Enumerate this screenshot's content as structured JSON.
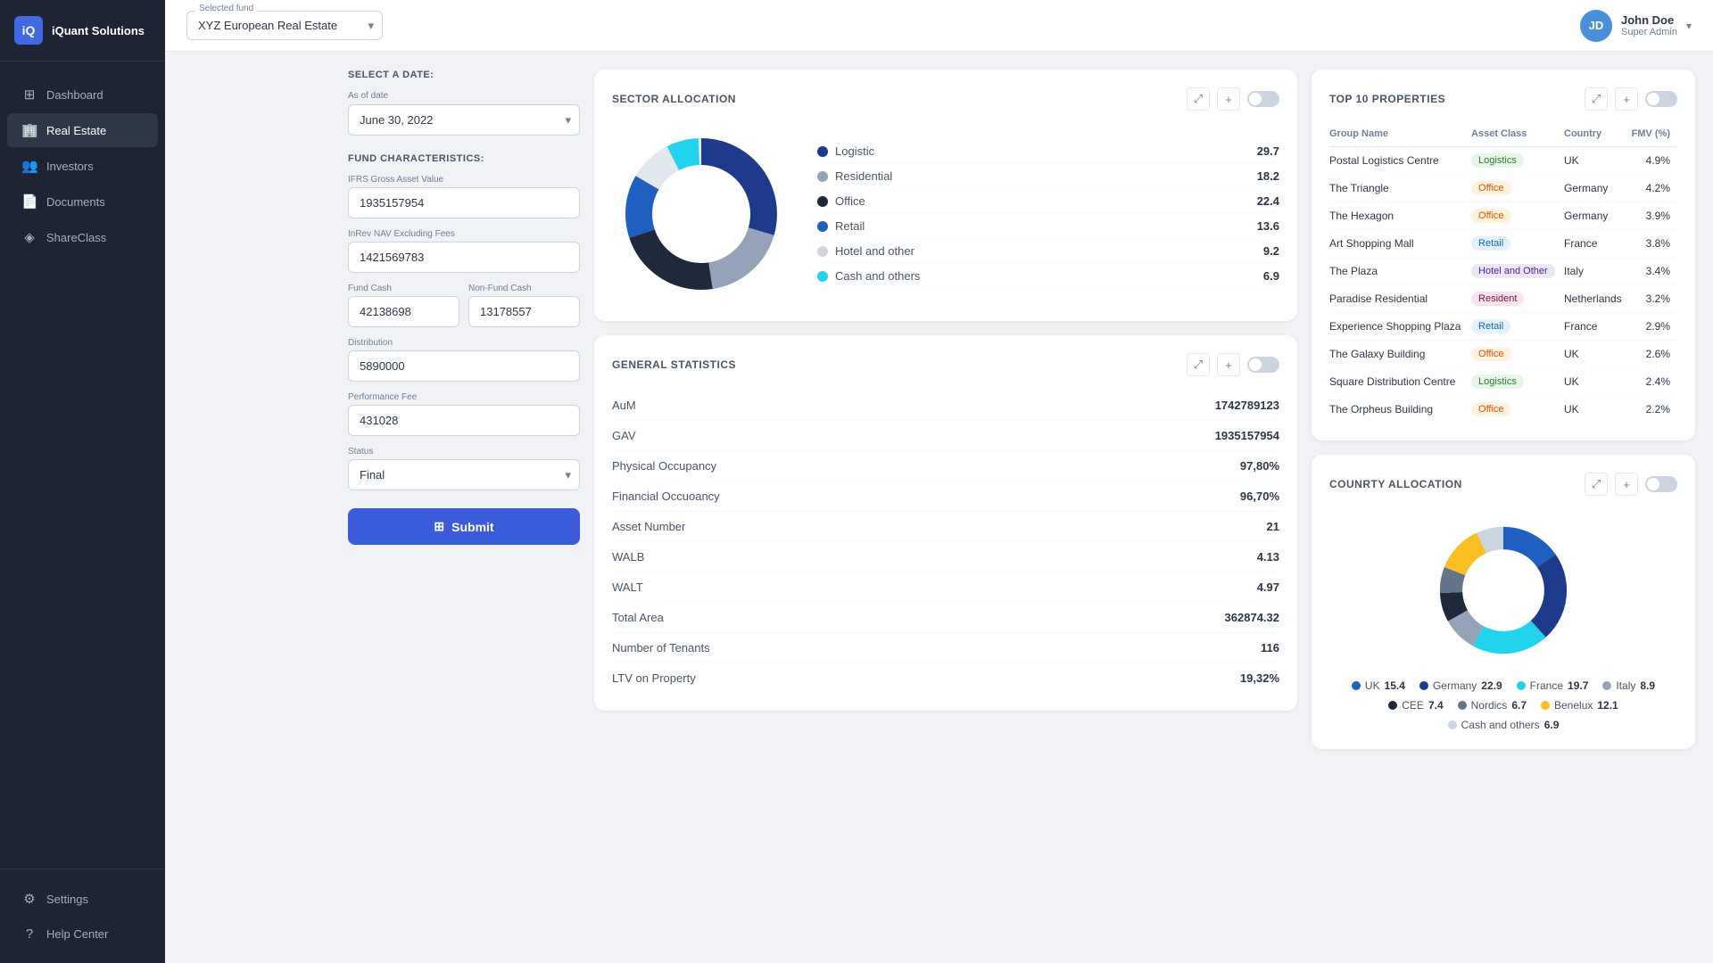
{
  "app": {
    "logo_text": "iQuant Solutions",
    "logo_initials": "iQ"
  },
  "sidebar": {
    "items": [
      {
        "id": "dashboard",
        "label": "Dashboard",
        "icon": "⊞",
        "active": false
      },
      {
        "id": "real-estate",
        "label": "Real Estate",
        "icon": "🏢",
        "active": true
      },
      {
        "id": "investors",
        "label": "Investors",
        "icon": "👥",
        "active": false
      },
      {
        "id": "documents",
        "label": "Documents",
        "icon": "📄",
        "active": false
      },
      {
        "id": "shareclass",
        "label": "ShareClass",
        "icon": "◈",
        "active": false
      }
    ],
    "bottom_items": [
      {
        "id": "settings",
        "label": "Settings",
        "icon": "⚙"
      },
      {
        "id": "help",
        "label": "Help Center",
        "icon": "?"
      }
    ]
  },
  "header": {
    "fund_label": "Selected fund",
    "fund_value": "XYZ European Real Estate",
    "user_name": "John Doe",
    "user_role": "Super Admin"
  },
  "left_panel": {
    "date_section_title": "SELECT A DATE:",
    "date_label": "As of date",
    "date_value": "June 30, 2022",
    "fund_chars_title": "FUND CHARACTERISTICS:",
    "ifrs_label": "IFRS Gross Asset Value",
    "ifrs_value": "1935157954",
    "inrev_label": "InRev NAV Excluding Fees",
    "inrev_value": "1421569783",
    "fund_cash_label": "Fund Cash",
    "fund_cash_value": "42138698",
    "non_fund_cash_label": "Non-Fund Cash",
    "non_fund_cash_value": "13178557",
    "distribution_label": "Distribution",
    "distribution_value": "5890000",
    "performance_fee_label": "Performance Fee",
    "performance_fee_value": "431028",
    "status_label": "Status",
    "status_value": "Final",
    "submit_label": "Submit"
  },
  "sector_allocation": {
    "title": "SECTOR ALLOCATION",
    "items": [
      {
        "label": "Logistic",
        "value": 29.7,
        "color": "#1e3a8a"
      },
      {
        "label": "Residential",
        "value": 18.2,
        "color": "#94a3b8"
      },
      {
        "label": "Office",
        "value": 22.4,
        "color": "#1e293b"
      },
      {
        "label": "Retail",
        "value": 13.6,
        "color": "#1e5fbf"
      },
      {
        "label": "Hotel and other",
        "value": 9.2,
        "color": "#e2e8f0"
      },
      {
        "label": "Cash and others",
        "value": 6.9,
        "color": "#22d3ee"
      }
    ]
  },
  "general_stats": {
    "title": "GENERAL STATISTICS",
    "rows": [
      {
        "label": "AuM",
        "value": "1742789123"
      },
      {
        "label": "GAV",
        "value": "1935157954"
      },
      {
        "label": "Physical Occupancy",
        "value": "97,80%"
      },
      {
        "label": "Financial Occuoancy",
        "value": "96,70%"
      },
      {
        "label": "Asset Number",
        "value": "21"
      },
      {
        "label": "WALB",
        "value": "4.13"
      },
      {
        "label": "WALT",
        "value": "4.97"
      },
      {
        "label": "Total Area",
        "value": "362874.32"
      },
      {
        "label": "Number of Tenants",
        "value": "116"
      },
      {
        "label": "LTV on Property",
        "value": "19,32%"
      }
    ]
  },
  "top10_properties": {
    "title": "TOP 10 PROPERTIES",
    "columns": [
      "Group Name",
      "Asset Class",
      "Country",
      "FMV (%)"
    ],
    "rows": [
      {
        "name": "Postal Logistics Centre",
        "asset_class": "Logistics",
        "asset_class_type": "logistics",
        "country": "UK",
        "fmv": "4.9%"
      },
      {
        "name": "The Triangle",
        "asset_class": "Office",
        "asset_class_type": "office",
        "country": "Germany",
        "fmv": "4.2%"
      },
      {
        "name": "The Hexagon",
        "asset_class": "Office",
        "asset_class_type": "office",
        "country": "Germany",
        "fmv": "3.9%"
      },
      {
        "name": "Art Shopping Mall",
        "asset_class": "Retail",
        "asset_class_type": "retail",
        "country": "France",
        "fmv": "3.8%"
      },
      {
        "name": "The Plaza",
        "asset_class": "Hotel and Other",
        "asset_class_type": "hotel",
        "country": "Italy",
        "fmv": "3.4%"
      },
      {
        "name": "Paradise Residential",
        "asset_class": "Resident",
        "asset_class_type": "resident",
        "country": "Netherlands",
        "fmv": "3.2%"
      },
      {
        "name": "Experience Shopping Plaza",
        "asset_class": "Retail",
        "asset_class_type": "retail",
        "country": "France",
        "fmv": "2.9%"
      },
      {
        "name": "The Galaxy Building",
        "asset_class": "Office",
        "asset_class_type": "office",
        "country": "UK",
        "fmv": "2.6%"
      },
      {
        "name": "Square Distribution Centre",
        "asset_class": "Logistics",
        "asset_class_type": "logistics",
        "country": "UK",
        "fmv": "2.4%"
      },
      {
        "name": "The Orpheus Building",
        "asset_class": "Office",
        "asset_class_type": "office",
        "country": "UK",
        "fmv": "2.2%"
      }
    ]
  },
  "country_allocation": {
    "title": "COUNRTY ALLOCATION",
    "items": [
      {
        "label": "UK",
        "value": 15.4,
        "color": "#1e5fbf"
      },
      {
        "label": "Germany",
        "value": 22.9,
        "color": "#1e3a8a"
      },
      {
        "label": "France",
        "value": 19.7,
        "color": "#22d3ee"
      },
      {
        "label": "Italy",
        "value": 8.9,
        "color": "#94a3b8"
      },
      {
        "label": "CEE",
        "value": 7.4,
        "color": "#1e293b"
      },
      {
        "label": "Nordics",
        "value": 6.7,
        "color": "#64748b"
      },
      {
        "label": "Benelux",
        "value": 12.1,
        "color": "#fbbf24"
      },
      {
        "label": "Cash and others",
        "value": 6.9,
        "color": "#cbd5e0"
      }
    ]
  }
}
